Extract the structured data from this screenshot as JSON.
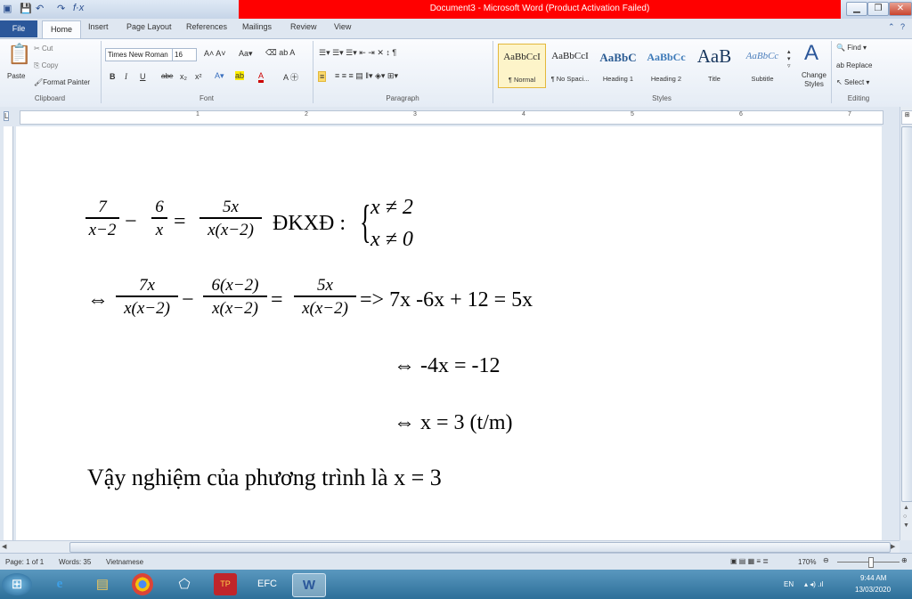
{
  "window": {
    "title": "Document3 - Microsoft Word (Product Activation Failed)",
    "controls": {
      "minimize": "▁",
      "restore": "❐",
      "close": "✕"
    }
  },
  "tabs": [
    "File",
    "Home",
    "Insert",
    "Page Layout",
    "References",
    "Mailings",
    "Review",
    "View"
  ],
  "ribbon": {
    "clipboard": {
      "paste": "Paste",
      "cut": "Cut",
      "copy": "Copy",
      "format_painter": "Format Painter",
      "label": "Clipboard"
    },
    "font": {
      "name": "Times New Roman",
      "size": "16",
      "label": "Font",
      "buttons": [
        "B",
        "I",
        "U",
        "abe",
        "x₂",
        "x²"
      ]
    },
    "paragraph": {
      "label": "Paragraph"
    },
    "styles": {
      "label": "Styles",
      "items": [
        {
          "preview": "AaBbCcI",
          "name": "¶ Normal"
        },
        {
          "preview": "AaBbCcI",
          "name": "¶ No Spaci..."
        },
        {
          "preview": "AaBbC",
          "name": "Heading 1"
        },
        {
          "preview": "AaBbCc",
          "name": "Heading 2"
        },
        {
          "preview": "AaB",
          "name": "Title"
        },
        {
          "preview": "AaBbCc",
          "name": "Subtitle"
        }
      ],
      "change_styles": "Change Styles"
    },
    "editing": {
      "find": "Find",
      "replace": "Replace",
      "select": "Select",
      "label": "Editing"
    }
  },
  "ruler_numbers": [
    "1",
    "2",
    "3",
    "4",
    "5",
    "6",
    "7"
  ],
  "document": {
    "line1": {
      "f1_num": "7",
      "f1_den": "x−2",
      "minus": "−",
      "f2_num": "6",
      "f2_den": "x",
      "equals": "=",
      "f3_num": "5x",
      "f3_den": "x(x−2)",
      "dkxd": "ĐKXĐ :",
      "cond1": "x  ≠ 2",
      "cond2": "x  ≠ 0"
    },
    "line2": {
      "arrow": "⇔",
      "f1_num": "7x",
      "f1_den": "x(x−2)",
      "minus": "−",
      "f2_num": "6(x−2)",
      "f2_den": "x(x−2)",
      "equals": "=",
      "f3_num": "5x",
      "f3_den": "x(x−2)",
      "rest": "=> 7x -6x + 12 = 5x"
    },
    "line3": "⇔ -4x = -12",
    "line4": "⇔ x = 3 (t/m)",
    "conclusion": "Vậy nghiệm  của phương trình là x = 3"
  },
  "status": {
    "page": "Page: 1 of 1",
    "words": "Words: 35",
    "language": "Vietnamese",
    "zoom": "170%"
  },
  "taskbar": {
    "lang": "EN",
    "time": "9:44 AM",
    "date": "13/03/2020"
  }
}
